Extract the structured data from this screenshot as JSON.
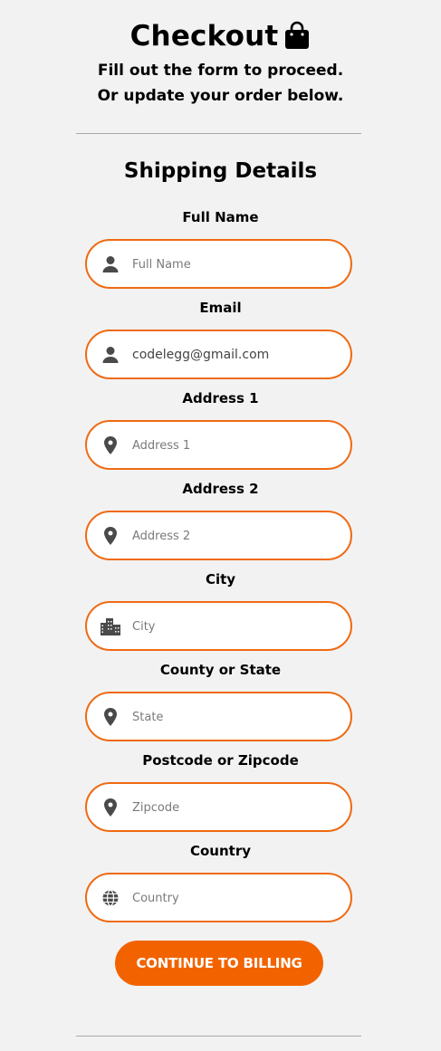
{
  "header": {
    "title": "Checkout",
    "subtitle_line1": "Fill out the form to proceed.",
    "subtitle_line2": "Or update your order below."
  },
  "section": {
    "title": "Shipping Details"
  },
  "fields": [
    {
      "label": "Full Name",
      "icon": "user-icon",
      "value": "",
      "placeholder": "Full Name"
    },
    {
      "label": "Email",
      "icon": "user-icon",
      "value": "codelegg@gmail.com",
      "placeholder": "Email"
    },
    {
      "label": "Address 1",
      "icon": "map-pin-icon",
      "value": "",
      "placeholder": "Address 1"
    },
    {
      "label": "Address 2",
      "icon": "map-pin-icon",
      "value": "",
      "placeholder": "Address 2"
    },
    {
      "label": "City",
      "icon": "city-icon",
      "value": "",
      "placeholder": "City"
    },
    {
      "label": "County or State",
      "icon": "map-pin-icon",
      "value": "",
      "placeholder": "State"
    },
    {
      "label": "Postcode or Zipcode",
      "icon": "map-pin-icon",
      "value": "",
      "placeholder": "Zipcode"
    },
    {
      "label": "Country",
      "icon": "globe-icon",
      "value": "",
      "placeholder": "Country"
    }
  ],
  "submit": {
    "label": "CONTINUE TO BILLING"
  },
  "colors": {
    "accent": "#f26300",
    "field_border": "#ef6a13",
    "background": "#f2f2f2",
    "icon": "#4a4a4a"
  }
}
